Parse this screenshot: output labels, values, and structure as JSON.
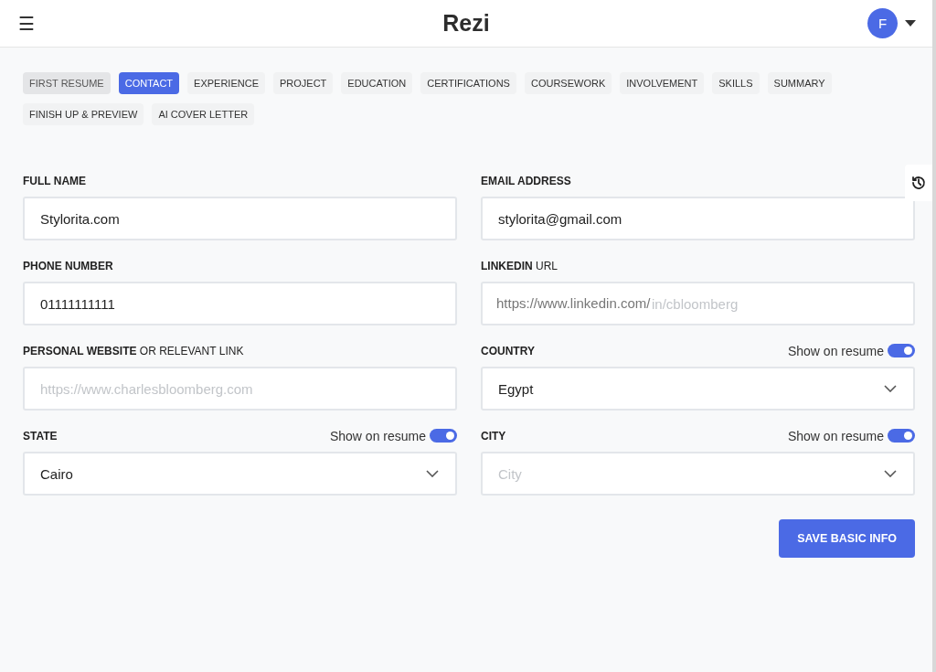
{
  "header": {
    "menu_icon": "☰",
    "logo": "Rezi",
    "avatar": "F"
  },
  "tabs": [
    {
      "label": "FIRST RESUME",
      "kind": "resume",
      "selected": false
    },
    {
      "label": "CONTACT",
      "kind": "step",
      "selected": true
    },
    {
      "label": "EXPERIENCE",
      "kind": "step",
      "selected": false
    },
    {
      "label": "PROJECT",
      "kind": "step",
      "selected": false
    },
    {
      "label": "EDUCATION",
      "kind": "step",
      "selected": false
    },
    {
      "label": "CERTIFICATIONS",
      "kind": "step",
      "selected": false
    },
    {
      "label": "COURSEWORK",
      "kind": "step",
      "selected": false
    },
    {
      "label": "INVOLVEMENT",
      "kind": "step",
      "selected": false
    },
    {
      "label": "SKILLS",
      "kind": "step",
      "selected": false
    },
    {
      "label": "SUMMARY",
      "kind": "step",
      "selected": false
    },
    {
      "label": "FINISH UP & PREVIEW",
      "kind": "step",
      "selected": false
    },
    {
      "label": "AI COVER LETTER",
      "kind": "step",
      "selected": false
    }
  ],
  "fields": [
    {
      "label": "FULL NAME",
      "kind": "text",
      "value": "Stylorita.com"
    },
    {
      "label": "EMAIL ADDRESS",
      "kind": "text",
      "value": "stylorita@gmail.com"
    },
    {
      "label": "PHONE NUMBER",
      "kind": "text",
      "value": "01111111111"
    },
    {
      "label": "LINKEDIN",
      "label_suffix": "URL",
      "kind": "text",
      "prefix": "https://www.linkedin.com/",
      "placeholder": "in/cbloomberg"
    },
    {
      "label": "PERSONAL WEBSITE",
      "label_suffix": "OR RELEVANT LINK",
      "kind": "text",
      "placeholder": "https://www.charlesbloomberg.com"
    },
    {
      "label": "COUNTRY",
      "kind": "select",
      "value": "Egypt",
      "toggle": {
        "label": "Show on resume",
        "on": true
      }
    },
    {
      "label": "STATE",
      "kind": "select",
      "value": "Cairo",
      "toggle": {
        "label": "Show on resume",
        "on": true
      }
    },
    {
      "label": "CITY",
      "kind": "select",
      "placeholder": "City",
      "toggle": {
        "label": "Show on resume",
        "on": true
      }
    }
  ],
  "save_button": "SAVE BASIC INFO"
}
